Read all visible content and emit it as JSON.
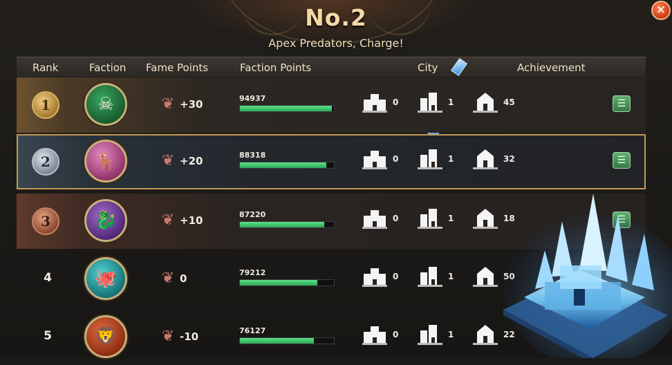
{
  "header": {
    "title": "No.2",
    "subtitle": "Apex Predators, Charge!",
    "close_icon": "close-x-icon"
  },
  "columns": {
    "rank": "Rank",
    "faction": "Faction",
    "fame_points": "Fame Points",
    "faction_points": "Faction Points",
    "city": "City",
    "achievement": "Achievement"
  },
  "rows": [
    {
      "rank": "1",
      "medal": "gold",
      "faction_icon": "skull-crown-icon",
      "faction_color": "#1f7a3f",
      "fame": "+30",
      "faction_points": "94937",
      "progress": 0.98,
      "city_a": "0",
      "city_b": "1",
      "city_c": "45",
      "highlight": false
    },
    {
      "rank": "2",
      "medal": "silver",
      "faction_icon": "stag-icon",
      "faction_color": "#b8508e",
      "fame": "+20",
      "faction_points": "88318",
      "progress": 0.92,
      "city_a": "0",
      "city_b": "1",
      "city_c": "32",
      "highlight": true
    },
    {
      "rank": "3",
      "medal": "bronze",
      "faction_icon": "dragon-icon",
      "faction_color": "#6a3a8e",
      "fame": "+10",
      "faction_points": "87220",
      "progress": 0.9,
      "city_a": "0",
      "city_b": "1",
      "city_c": "18",
      "highlight": false
    },
    {
      "rank": "4",
      "medal": "none",
      "faction_icon": "kraken-icon",
      "faction_color": "#1f9a9a",
      "fame": "0",
      "faction_points": "79212",
      "progress": 0.82,
      "city_a": "0",
      "city_b": "1",
      "city_c": "50",
      "highlight": false
    },
    {
      "rank": "5",
      "medal": "none",
      "faction_icon": "lion-icon",
      "faction_color": "#b3401e",
      "fame": "-10",
      "faction_points": "76127",
      "progress": 0.79,
      "city_a": "0",
      "city_b": "1",
      "city_c": "22",
      "highlight": false
    }
  ],
  "colors": {
    "accent_gold": "#c49a55",
    "progress_green": "#2aa657",
    "achievement_green": "#347a45"
  }
}
